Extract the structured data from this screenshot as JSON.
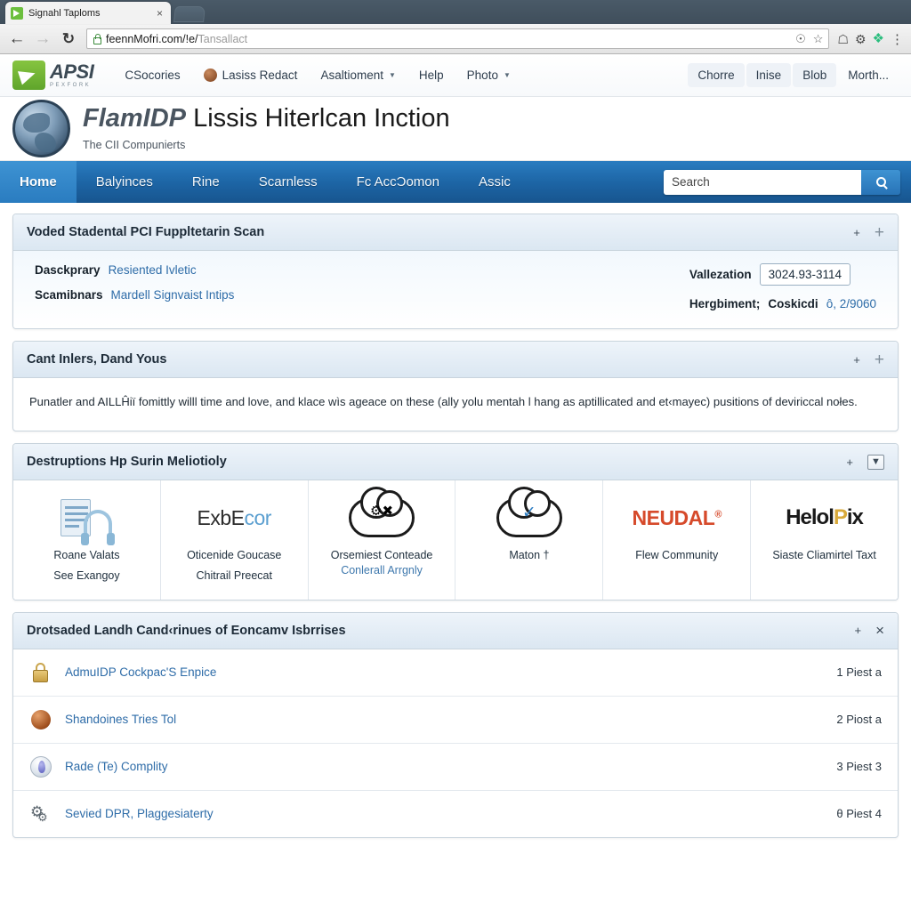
{
  "browser": {
    "tab_title": "Signahl Taploms",
    "tab_close": "×",
    "back_icon": "←",
    "forward_icon": "→",
    "reload_icon": "↻",
    "url_main": "feennMofri",
    "url_rest": ".com/!e/",
    "url_dim": "Tansallact",
    "omni_icons": [
      "star-outline-icon",
      "bookmark-star-icon"
    ],
    "toolbar_icons": [
      "home-icon",
      "extension-icon",
      "puzzle-icon",
      "menu-icon"
    ]
  },
  "topnav": {
    "brand_name": "APSI",
    "brand_sub": "PEXFORK",
    "links": [
      {
        "label": "CSocories",
        "badge": false,
        "caret": false
      },
      {
        "label": "Lasiss Redact",
        "badge": true,
        "caret": false
      },
      {
        "label": "Asaltioment",
        "badge": false,
        "caret": true
      },
      {
        "label": "Help",
        "badge": false,
        "caret": false
      },
      {
        "label": "Photo",
        "badge": false,
        "caret": true
      }
    ],
    "right": [
      {
        "label": "Chorre",
        "filled": true
      },
      {
        "label": "Inise",
        "filled": true
      },
      {
        "label": "Blob",
        "filled": true
      },
      {
        "label": "Morth...",
        "filled": false
      }
    ]
  },
  "siteheader": {
    "title_em": "FlamIDP",
    "title_rest": "Lissis Hiterlcan Inction",
    "tagline": "The CII Compunierts"
  },
  "mainnav": {
    "items": [
      "Home",
      "Balyinces",
      "Rine",
      "Scarnless",
      "Fc AccƆomon",
      "Assic"
    ],
    "active": "Home",
    "search_value": "Search",
    "search_placeholder": "Search",
    "search_button_icon": "search-icon"
  },
  "panel1": {
    "title": "Voded Stadental PCI Fuppltetarin Scan",
    "actions": {
      "small": "+",
      "big": "+"
    },
    "left_rows": [
      {
        "key": "Dasckprary",
        "value": "Resiented Ivletic"
      },
      {
        "key": "Scamibnars",
        "value": "Mardell Signvaist Intips"
      }
    ],
    "right_rows": [
      {
        "key": "Vallezation",
        "value": "3024.93-3114",
        "boxed": true
      },
      {
        "key": "Hergbiment;",
        "value_bold": "Coskicdi",
        "value_rest": "ô, 2/9060",
        "boxed": false
      }
    ]
  },
  "panel2": {
    "title": "Cant Inlers, Dand Yous",
    "actions": {
      "small": "+",
      "big": "+"
    },
    "body": "Punatler and AILLĤiï fomittly willl time and love, and klace wìs ageace on these (ally yolu mentah l hang as aptillicated and et‹mayec) pusitions of deviriccal nołes."
  },
  "panel3": {
    "title": "Destruptions Hp Surin Meliotioly",
    "actions": {
      "small": "+",
      "box": "▼"
    },
    "cells": [
      {
        "art": "doc-headset-icon",
        "wordmark": "",
        "cap1": "Roane Valats",
        "cap2_dark": "See Exangoy",
        "cap2": ""
      },
      {
        "art": "",
        "wordmark": "ExbE",
        "wordmark_tail": "cor",
        "cap1": "Oticenide Goucase",
        "cap2_dark": "Chitrail Preecat",
        "cap2": ""
      },
      {
        "art": "cloud-gears-icon",
        "wordmark": "",
        "cap1": "Orsemiest Conteade",
        "cap2": "Conlerall Arrgnly"
      },
      {
        "art": "cloud-check-icon",
        "wordmark": "",
        "cap1": "Maton †",
        "cap2": ""
      },
      {
        "art": "",
        "wordmark": "NEUDAL",
        "wordmark_reg": "®",
        "cap1": "Flew Community",
        "cap2": ""
      },
      {
        "art": "",
        "wordmark": "Helol",
        "wordmark_gold": "P",
        "wordmark_end": "ix",
        "cap1": "Siaste Cliamirtel Taxt",
        "cap2": ""
      }
    ]
  },
  "panel4": {
    "title": "Drotsaded Landh Cand‹rinues of Eoncamᴠ Isbrrises",
    "actions": {
      "small": "+",
      "close": "×"
    },
    "rows": [
      {
        "icon": "lock-icon",
        "label": "AdmuIDP Cockpac'S Enpice",
        "meta": "1 Piest a"
      },
      {
        "icon": "firefox-icon",
        "label": "Shandoines Tries Tol",
        "meta": "2 Piost a"
      },
      {
        "icon": "orb-icon",
        "label": "Rade (Te) Complity",
        "meta": "3 Piest 3"
      },
      {
        "icon": "gears-icon",
        "label": "Sevied DPR, Plaggesiaterty",
        "meta": "θ Piest 4"
      }
    ]
  }
}
